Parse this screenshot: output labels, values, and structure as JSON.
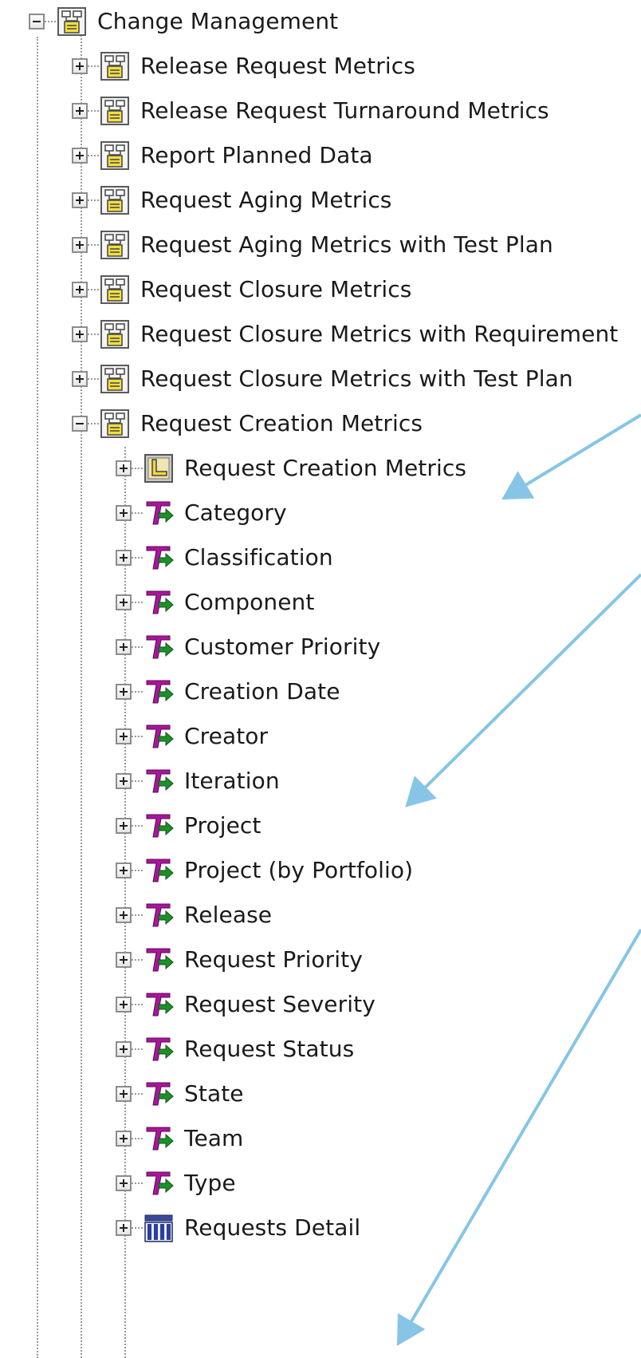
{
  "tree": {
    "root": {
      "label": "Change Management",
      "icon": "cube-folder-icon",
      "state": "expanded"
    },
    "children": [
      {
        "label": "Release Request Metrics",
        "icon": "cube-folder-icon",
        "state": "collapsed"
      },
      {
        "label": "Release Request Turnaround Metrics",
        "icon": "cube-folder-icon",
        "state": "collapsed"
      },
      {
        "label": "Report Planned Data",
        "icon": "cube-folder-icon",
        "state": "collapsed"
      },
      {
        "label": "Request Aging Metrics",
        "icon": "cube-folder-icon",
        "state": "collapsed"
      },
      {
        "label": "Request Aging Metrics with Test Plan",
        "icon": "cube-folder-icon",
        "state": "collapsed"
      },
      {
        "label": "Request Closure Metrics",
        "icon": "cube-folder-icon",
        "state": "collapsed"
      },
      {
        "label": "Request Closure Metrics with Requirement",
        "icon": "cube-folder-icon",
        "state": "collapsed"
      },
      {
        "label": "Request Closure Metrics with Test Plan",
        "icon": "cube-folder-icon",
        "state": "collapsed"
      },
      {
        "label": "Request Creation Metrics",
        "icon": "cube-folder-icon",
        "state": "expanded"
      }
    ],
    "subitems": [
      {
        "label": "Request Creation Metrics",
        "icon": "measure-group-icon"
      },
      {
        "label": "Category",
        "icon": "dimension-icon"
      },
      {
        "label": "Classification",
        "icon": "dimension-icon"
      },
      {
        "label": "Component",
        "icon": "dimension-icon"
      },
      {
        "label": "Customer Priority",
        "icon": "dimension-icon"
      },
      {
        "label": "Creation Date",
        "icon": "dimension-icon"
      },
      {
        "label": "Creator",
        "icon": "dimension-icon"
      },
      {
        "label": "Iteration",
        "icon": "dimension-icon"
      },
      {
        "label": "Project",
        "icon": "dimension-icon"
      },
      {
        "label": "Project (by Portfolio)",
        "icon": "dimension-icon"
      },
      {
        "label": "Release",
        "icon": "dimension-icon"
      },
      {
        "label": "Request Priority",
        "icon": "dimension-icon"
      },
      {
        "label": "Request Severity",
        "icon": "dimension-icon"
      },
      {
        "label": "Request Status",
        "icon": "dimension-icon"
      },
      {
        "label": "State",
        "icon": "dimension-icon"
      },
      {
        "label": "Team",
        "icon": "dimension-icon"
      },
      {
        "label": "Type",
        "icon": "dimension-icon"
      },
      {
        "label": "Requests Detail",
        "icon": "table-icon"
      }
    ]
  },
  "colors": {
    "annotation_arrow": "#86c5e6",
    "guide_line": "#9a9a9a",
    "cube_yellow": "#f2df3f",
    "dimension_purple": "#a8169a",
    "dimension_green": "#1e8f2a",
    "table_blue": "#2b3f9c"
  }
}
